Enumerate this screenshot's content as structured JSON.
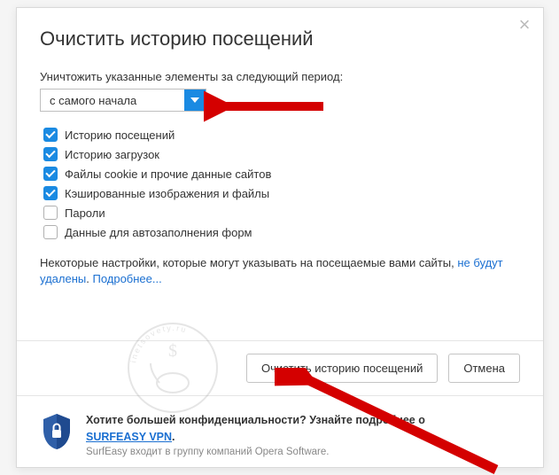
{
  "dialog": {
    "title": "Очистить историю посещений",
    "period_label": "Уничтожить указанные элементы за следующий период:",
    "period_value": "с самого начала",
    "options": [
      {
        "label": "Историю посещений",
        "checked": true
      },
      {
        "label": "Историю загрузок",
        "checked": true
      },
      {
        "label": "Файлы cookie и прочие данные сайтов",
        "checked": true
      },
      {
        "label": "Кэшированные изображения и файлы",
        "checked": true
      },
      {
        "label": "Пароли",
        "checked": false
      },
      {
        "label": "Данные для автозаполнения форм",
        "checked": false
      }
    ],
    "notice_prefix": "Некоторые настройки, которые могут указывать на посещаемые вами сайты, ",
    "notice_link1": "не будут удалены",
    "notice_sep": ". ",
    "notice_link2": "Подробнее...",
    "buttons": {
      "clear": "Очистить историю посещений",
      "cancel": "Отмена"
    },
    "promo": {
      "headline": "Хотите большей конфиденциальности? Узнайте подробнее о ",
      "product": "SURFEASY VPN",
      "dot": ".",
      "sub": "SurfEasy входит в группу компаний Opera Software."
    }
  }
}
